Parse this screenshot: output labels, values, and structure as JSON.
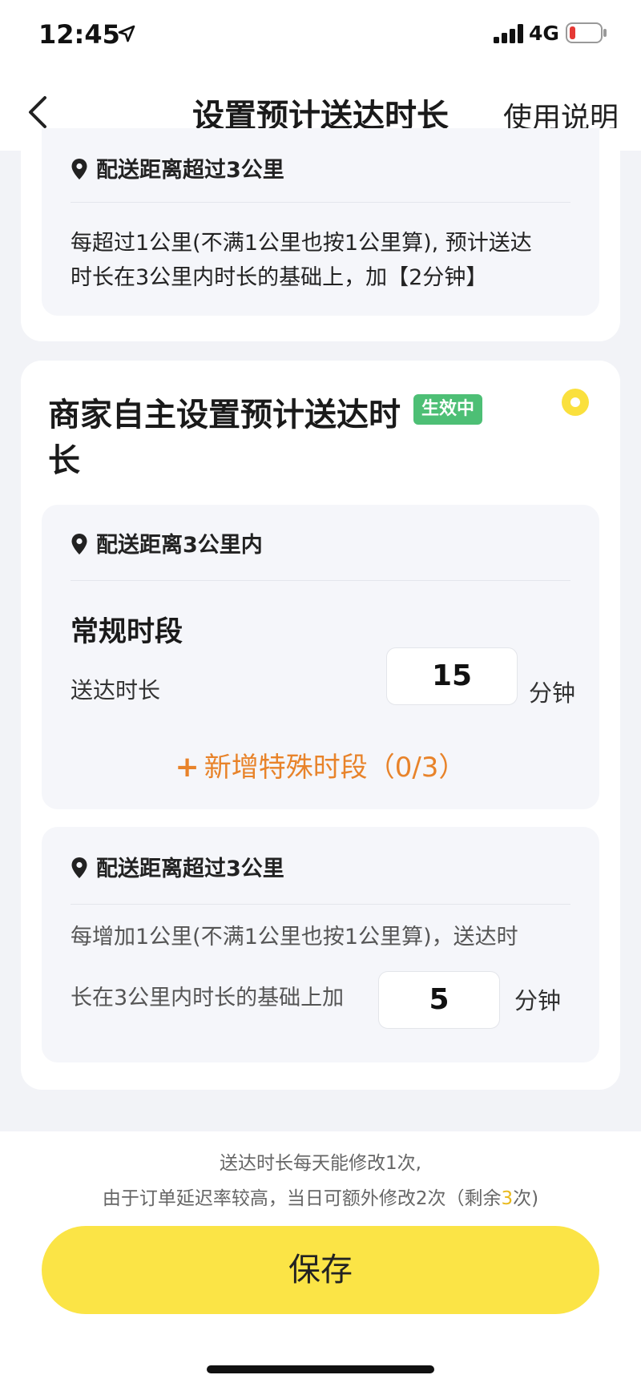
{
  "status_bar": {
    "time": "12:45",
    "network": "4G",
    "icons": [
      "location-arrow-icon",
      "signal-bars-icon",
      "battery-low-icon"
    ]
  },
  "nav": {
    "back_icon": "chevron-left-icon",
    "title": "设置预计送达时长",
    "help": "使用说明"
  },
  "platform_card": {
    "beyond_3km": {
      "heading": "配送距离超过3公里",
      "description_line1": "每超过1公里(不满1公里也按1公里算), 预计送达",
      "description_line2": "时长在3公里内时长的基础上，加【2分钟】"
    }
  },
  "merchant_card": {
    "title": "商家自主设置预计送达时长",
    "status_badge": "生效中",
    "radio_selected": true,
    "within_3km": {
      "heading": "配送距离3公里内",
      "section_title": "常规时段",
      "duration_label": "送达时长",
      "duration_value": "15",
      "unit": "分钟",
      "add_special_period": "新增特殊时段（0/3）"
    },
    "beyond_3km": {
      "heading": "配送距离超过3公里",
      "description_line1": "每增加1公里(不满1公里也按1公里算)，送达时",
      "description_line2": "长在3公里内时长的基础上加",
      "extra_value": "5",
      "unit": "分钟"
    }
  },
  "footer": {
    "notice_line1": "送达时长每天能修改1次,",
    "notice_line2_prefix": "由于订单延迟率较高，当日可额外修改2次（剩余",
    "remaining_count": "3",
    "notice_line2_suffix": "次)",
    "save_button": "保存"
  },
  "colors": {
    "accent_yellow": "#fbe446",
    "radio_yellow": "#fae03d",
    "badge_green": "#4dbf75",
    "add_link_orange": "#e8832a",
    "remaining_highlight": "#e9b91c"
  }
}
